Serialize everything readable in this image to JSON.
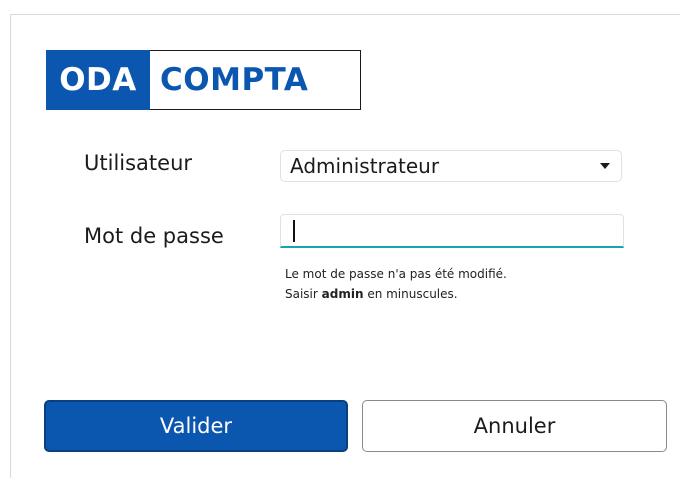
{
  "logo": {
    "left_text": "ODA",
    "right_text": "COMPTA",
    "brand_color": "#0b57b0"
  },
  "form": {
    "user_label": "Utilisateur",
    "user_value": "Administrateur",
    "password_label": "Mot de passe",
    "password_value": "",
    "hint_line1": "Le mot de passe n'a pas été modifié.",
    "hint_line2_prefix": "Saisir ",
    "hint_line2_bold": "admin",
    "hint_line2_suffix": " en minuscules."
  },
  "buttons": {
    "ok_label": "Valider",
    "cancel_label": "Annuler"
  },
  "colors": {
    "accent": "#0b57b0",
    "focus_underline": "#18a3b3"
  },
  "icons": {
    "select_caret": "chevron-down-icon"
  }
}
